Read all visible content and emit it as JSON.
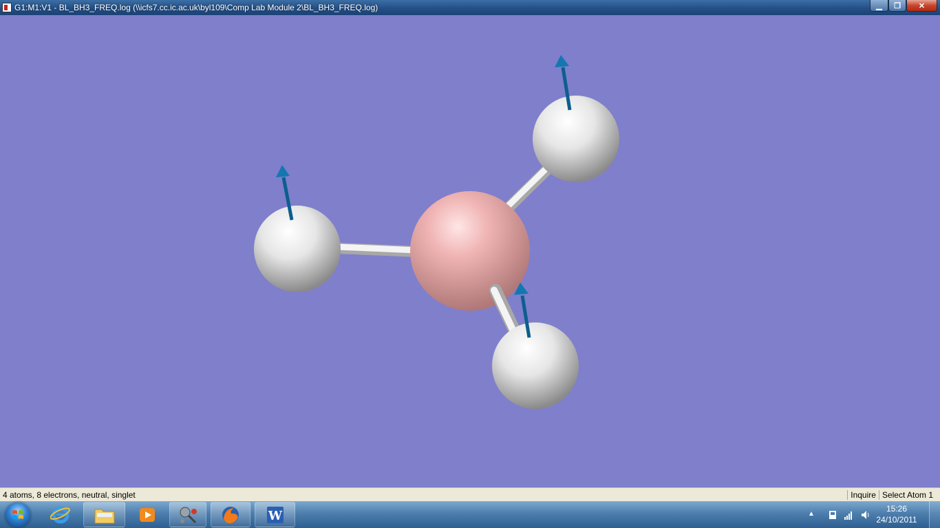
{
  "window": {
    "title": "G1:M1:V1 - BL_BH3_FREQ.log (\\\\icfs7.cc.ic.ac.uk\\byl109\\Comp Lab Module 2\\BL_BH3_FREQ.log)",
    "minimize_icon": "minimize-icon",
    "maximize_icon": "restore-icon",
    "close_icon": "close-icon"
  },
  "viewport": {
    "background_color": "#7f7fcc",
    "molecule": {
      "atoms": [
        {
          "element": "B",
          "color": "#f0b0b0"
        },
        {
          "element": "H",
          "color": "#ffffff"
        },
        {
          "element": "H",
          "color": "#ffffff"
        },
        {
          "element": "H",
          "color": "#ffffff"
        }
      ],
      "displacement_vector_color": "#0f6a9e"
    }
  },
  "statusbar": {
    "left_text": "4 atoms, 8 electrons, neutral, singlet",
    "mode": "Inquire",
    "action": "Select Atom 1"
  },
  "taskbar": {
    "apps": [
      {
        "name": "internet-explorer-icon"
      },
      {
        "name": "folder-icon"
      },
      {
        "name": "media-player-icon"
      },
      {
        "name": "gaussview-icon"
      },
      {
        "name": "firefox-icon"
      },
      {
        "name": "word-icon"
      }
    ],
    "clock_time": "15:26",
    "clock_date": "24/10/2011"
  }
}
